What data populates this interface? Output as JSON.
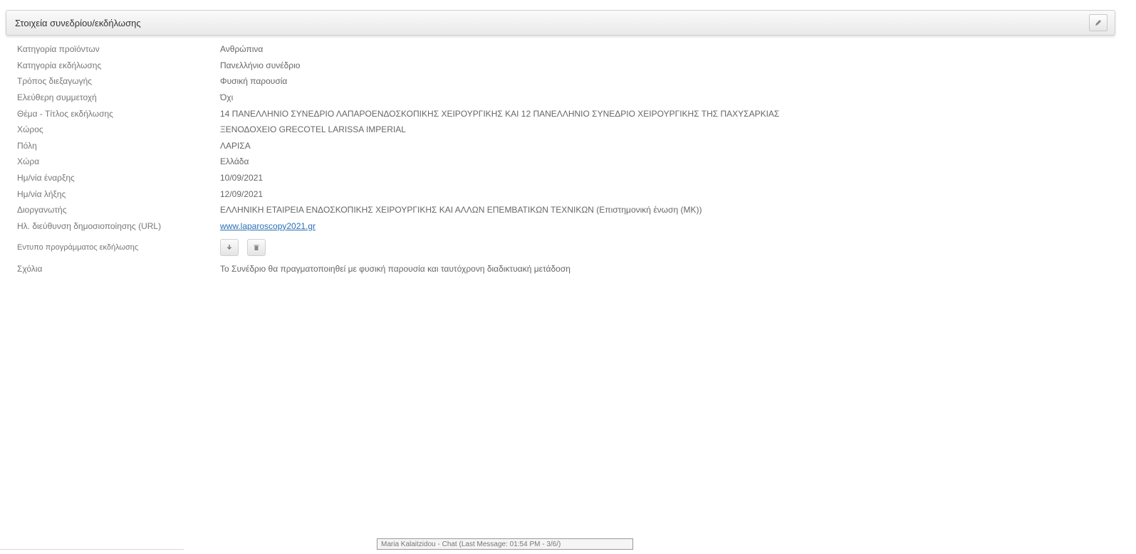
{
  "panel": {
    "title": "Στοιχεία συνεδρίου/εκδήλωσης"
  },
  "rows": [
    {
      "label": "Κατηγορία προϊόντων",
      "value": "Ανθρώπινα"
    },
    {
      "label": "Κατηγορία εκδήλωσης",
      "value": "Πανελλήνιο συνέδριο"
    },
    {
      "label": "Τρόπος διεξαγωγής",
      "value": "Φυσική παρουσία"
    },
    {
      "label": "Ελεύθερη συμμετοχή",
      "value": "Όχι"
    },
    {
      "label": "Θέμα - Τίτλος εκδήλωσης",
      "value": "14 ΠΑΝΕΛΛΗΝΙΟ ΣΥΝΕΔΡΙΟ ΛΑΠΑΡΟΕΝΔΟΣΚΟΠΙΚΗΣ ΧΕΙΡΟΥΡΓΙΚΗΣ ΚΑΙ 12 ΠΑΝΕΛΛΗΝΙΟ ΣΥΝΕΔΡΙΟ ΧΕΙΡΟΥΡΓΙΚΗΣ ΤΗΣ ΠΑΧΥΣΑΡΚΙΑΣ"
    },
    {
      "label": "Χώρος",
      "value": "ΞΕΝΟΔΟΧΕΙΟ GRECOTEL LARISSA IMPERIAL"
    },
    {
      "label": "Πόλη",
      "value": "ΛΑΡΙΣΑ"
    },
    {
      "label": "Χώρα",
      "value": "Ελλάδα"
    },
    {
      "label": "Ημ/νία έναρξης",
      "value": "10/09/2021"
    },
    {
      "label": "Ημ/νία λήξης",
      "value": "12/09/2021"
    },
    {
      "label": "Διοργανωτής",
      "value": "ΕΛΛΗΝΙΚΗ ΕΤΑΙΡΕΙΑ ΕΝΔΟΣΚΟΠΙΚΗΣ ΧΕΙΡΟΥΡΓΙΚΗΣ ΚΑΙ ΑΛΛΩΝ ΕΠΕΜΒΑΤΙΚΩΝ ΤΕΧΝΙΚΩΝ (Επιστημονική ένωση (ΜΚ))"
    },
    {
      "label": "Ηλ. διεύθυνση δημοσιοποίησης (URL)",
      "value": "www.laparoscopy2021.gr"
    },
    {
      "label": "Εντυπο προγράμματος εκδήλωσης",
      "value": ""
    },
    {
      "label": "Σχόλια",
      "value": "Το Συνέδριο θα πραγματοποιηθεί με φυσική παρουσία και ταυτόχρονη διαδικτυακή μετάδοση"
    }
  ],
  "icons": {
    "edit": "pencil-icon",
    "download": "download-icon",
    "delete": "trash-icon"
  },
  "footer": {
    "status_text": "Maria Kalaitzidou - Chat (Last Message: 01:54 PM - 3/6/)"
  },
  "colors": {
    "link": "#2a6fb5",
    "header_bg": "#efefef"
  }
}
